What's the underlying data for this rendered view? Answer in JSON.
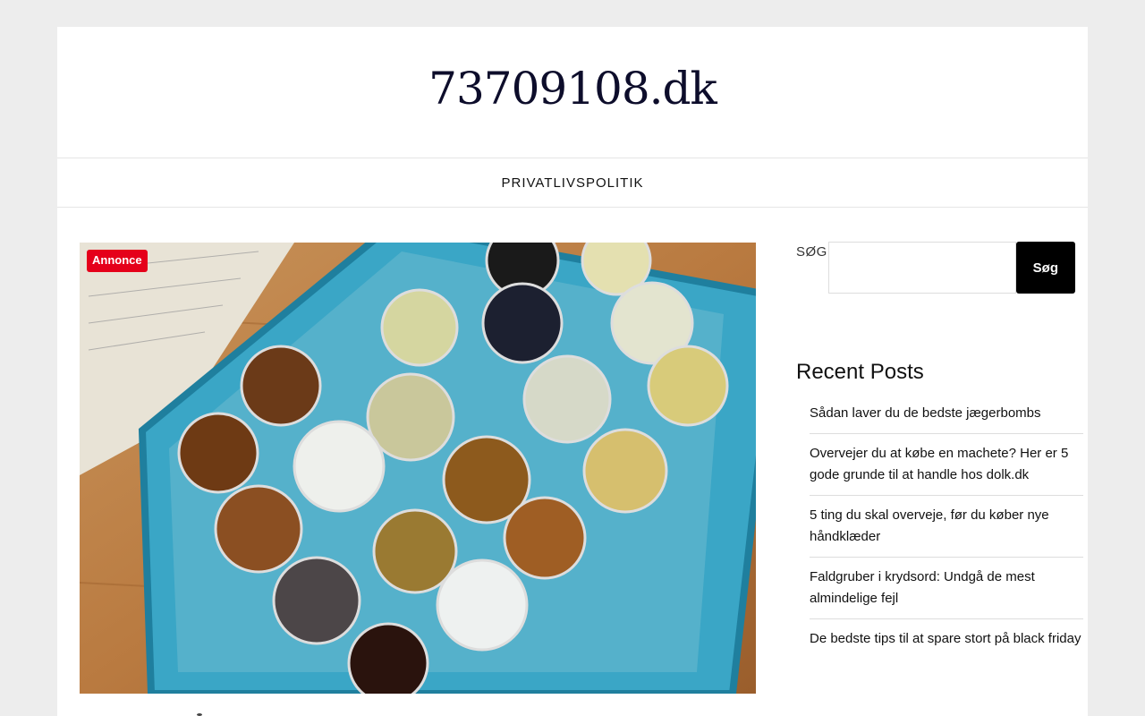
{
  "site": {
    "title": "73709108.dk"
  },
  "nav": {
    "items": [
      {
        "label": "PRIVATLIVSPOLITIK"
      }
    ]
  },
  "article": {
    "tag": "Annonce"
  },
  "sidebar": {
    "search": {
      "label": "SØG",
      "button_label": "Søg",
      "value": "",
      "placeholder": ""
    },
    "recent_posts": {
      "title": "Recent Posts",
      "items": [
        {
          "label": "Sådan laver du de bedste jægerbombs"
        },
        {
          "label": "Overvejer du at købe en machete? Her er 5 gode grunde til at handle hos dolk.dk"
        },
        {
          "label": "5 ting du skal overveje, før du køber nye håndklæder"
        },
        {
          "label": "Faldgruber i krydsord: Undgå de mest almindelige fejl"
        },
        {
          "label": "De bedste tips til at spare stort på black friday"
        }
      ]
    }
  },
  "colors": {
    "background": "#ededed",
    "panel": "#ffffff",
    "tag": "#e5001a",
    "button": "#000000",
    "title": "#0d0d2b"
  }
}
